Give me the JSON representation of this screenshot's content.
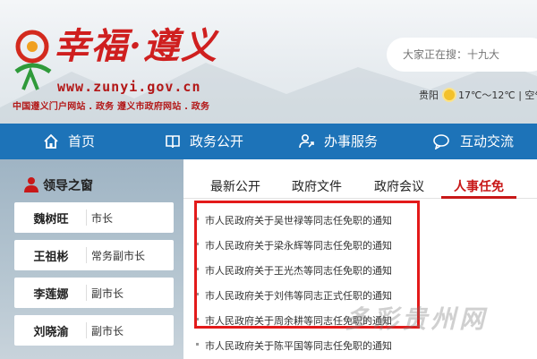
{
  "header": {
    "site_title": "幸福·遵义",
    "site_url": "www.zunyi.gov.cn",
    "site_subtitle": "中国遵义门户网站 . 政务 遵义市政府网站 . 政务",
    "search_placeholder": "大家正在搜：十九大",
    "weather": {
      "city": "贵阳",
      "temperature": "17℃～12℃",
      "extra": "空气"
    }
  },
  "nav": {
    "items": [
      {
        "label": "首页",
        "icon": "home-icon"
      },
      {
        "label": "政务公开",
        "icon": "book-icon"
      },
      {
        "label": "办事服务",
        "icon": "service-icon"
      },
      {
        "label": "互动交流",
        "icon": "chat-icon"
      }
    ]
  },
  "leaders": {
    "title": "领导之窗",
    "icon": "person-icon",
    "items": [
      {
        "name": "魏树旺",
        "role": "市长"
      },
      {
        "name": "王祖彬",
        "role": "常务副市长"
      },
      {
        "name": "李莲娜",
        "role": "副市长"
      },
      {
        "name": "刘晓渝",
        "role": "副市长"
      }
    ]
  },
  "tabs": {
    "items": [
      "最新公开",
      "政府文件",
      "政府会议",
      "人事任免"
    ],
    "active_index": 3
  },
  "news": {
    "items": [
      "市人民政府关于吴世禄等同志任免职的通知",
      "市人民政府关于梁永辉等同志任免职的通知",
      "市人民政府关于王光杰等同志任免职的通知",
      "市人民政府关于刘伟等同志正式任职的通知",
      "市人民政府关于周余耕等同志任免职的通知",
      "市人民政府关于陈平国等同志任免职的通知"
    ]
  },
  "watermark": "多彩贵州网",
  "colors": {
    "nav_blue": "#1d73b8",
    "accent_red": "#c81818",
    "highlight_red": "#e31a1a"
  }
}
